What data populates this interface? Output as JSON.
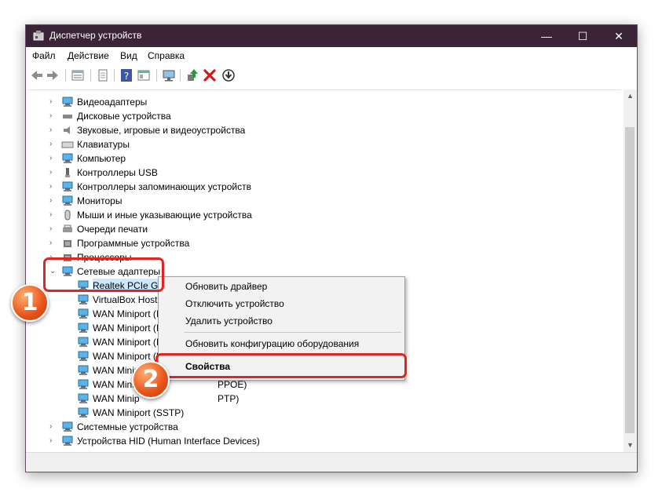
{
  "window": {
    "title": "Диспетчер устройств",
    "controls": {
      "minimize": "—",
      "maximize": "☐",
      "close": "✕"
    }
  },
  "menu": [
    "Файл",
    "Действие",
    "Вид",
    "Справка"
  ],
  "toolbar_icons": [
    "back-arrow-icon",
    "forward-arrow-icon",
    "properties-sheet-icon",
    "print-icon",
    "help-icon",
    "view-icon",
    "monitor-icon",
    "update-driver-icon",
    "delete-icon",
    "download-icon"
  ],
  "tree": {
    "categories": [
      "Видеоадаптеры",
      "Дисковые устройства",
      "Звуковые, игровые и видеоустройства",
      "Клавиатуры",
      "Компьютер",
      "Контроллеры USB",
      "Контроллеры запоминающих устройств",
      "Мониторы",
      "Мыши и иные указывающие устройства",
      "Очереди печати",
      "Программные устройства",
      "Процессоры"
    ],
    "expanded": {
      "label": "Сетевые адаптеры",
      "children": [
        "Realtek PCIe GBE",
        "VirtualBox Host-",
        "WAN Miniport (I",
        "WAN Miniport (I",
        "WAN Miniport (I",
        "WAN Miniport (L",
        "WAN Minip",
        "WAN Minip",
        "WAN Minip",
        "WAN Miniport (SSTP)"
      ],
      "child_tails": [
        "",
        "",
        "",
        "",
        "",
        "",
        "",
        "PPOE)",
        "PTP)",
        ""
      ]
    },
    "after": [
      "Системные устройства",
      "Устройства HID (Human Interface Devices)"
    ]
  },
  "context_menu": {
    "items": [
      "Обновить драйвер",
      "Отключить устройство",
      "Удалить устройство",
      "Обновить конфигурацию оборудования",
      "Свойства"
    ]
  },
  "annotations": {
    "badge1": "1",
    "badge2": "2"
  },
  "colors": {
    "titlebar": "#3b2438",
    "highlight": "#e02525",
    "badge": "#e8521a"
  }
}
